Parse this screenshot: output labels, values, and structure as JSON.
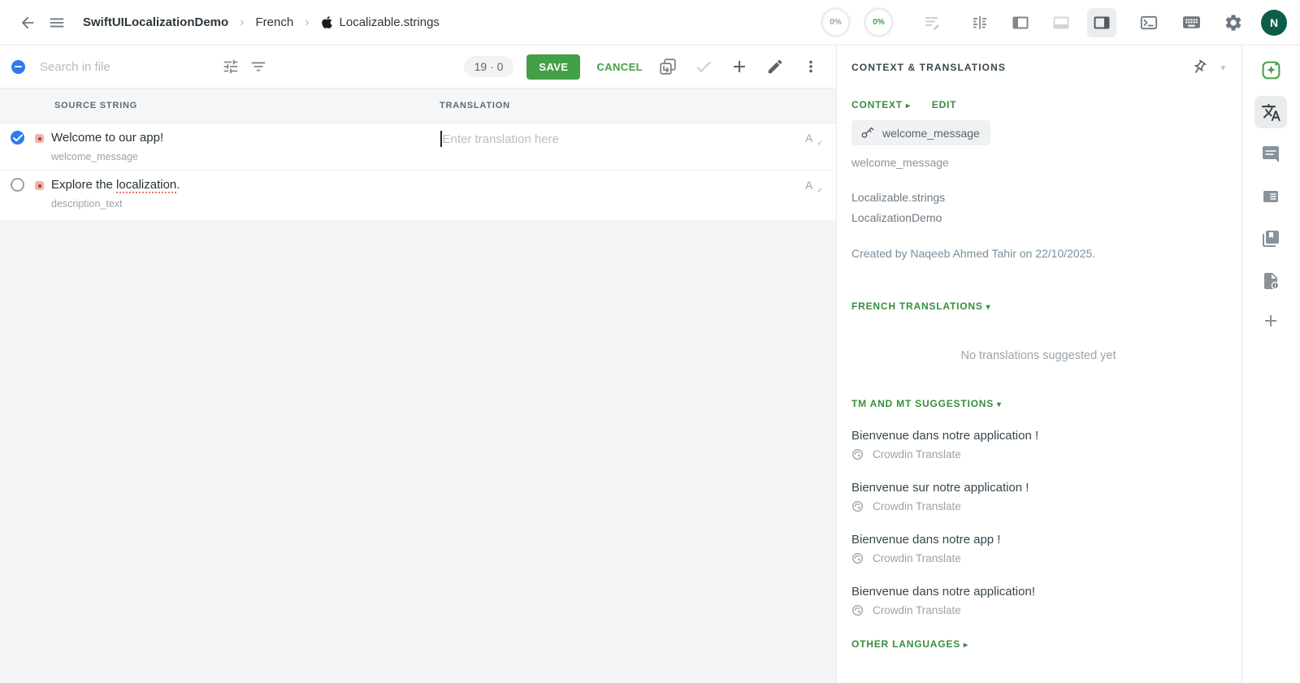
{
  "topbar": {
    "breadcrumb": {
      "project": "SwiftUILocalizationDemo",
      "language": "French",
      "file": "Localizable.strings"
    },
    "progress": {
      "translated": "0%",
      "approved": "0%"
    },
    "avatar_initial": "N"
  },
  "toolbar": {
    "search_placeholder": "Search in file",
    "counts": "19 · 0",
    "save_label": "SAVE",
    "cancel_label": "CANCEL"
  },
  "table": {
    "columns": {
      "source": "SOURCE STRING",
      "translation": "TRANSLATION"
    },
    "rows": {
      "0": {
        "source": "Welcome to our app!",
        "key": "welcome_message",
        "translation_placeholder": "Enter translation here"
      },
      "1": {
        "source_prefix": "Explore the ",
        "source_underlined": "localization",
        "source_suffix": ".",
        "key": "description_text"
      }
    }
  },
  "context_panel": {
    "title": "CONTEXT & TRANSLATIONS",
    "context_label": "CONTEXT",
    "edit_label": "EDIT",
    "key_pill": "welcome_message",
    "key_name": "welcome_message",
    "file_name": "Localizable.strings",
    "project_name": "LocalizationDemo",
    "created_line": "Created by Naqeeb Ahmed Tahir on 22/10/2025.",
    "translations_section": "FRENCH TRANSLATIONS",
    "no_translations_msg": "No translations suggested yet",
    "suggestions_section": "TM AND MT SUGGESTIONS",
    "suggestions": {
      "0": {
        "text": "Bienvenue dans notre application !",
        "provider": "Crowdin Translate"
      },
      "1": {
        "text": "Bienvenue sur notre application !",
        "provider": "Crowdin Translate"
      },
      "2": {
        "text": "Bienvenue dans notre app !",
        "provider": "Crowdin Translate"
      },
      "3": {
        "text": "Bienvenue dans notre application!",
        "provider": "Crowdin Translate"
      }
    },
    "other_languages": "OTHER LANGUAGES"
  },
  "icons": {
    "breadcrumb_chevron": "›",
    "caret_right": "▸",
    "caret_down": "▾",
    "spellcheck_letter": "A",
    "spellcheck_check": "✓"
  },
  "colors": {
    "accent_green": "#43a047",
    "link_green": "#388e3c",
    "checkbox_blue": "#2b7de9",
    "status_untranslated": "#f0b4ae",
    "avatar_bg": "#0b5d49"
  }
}
